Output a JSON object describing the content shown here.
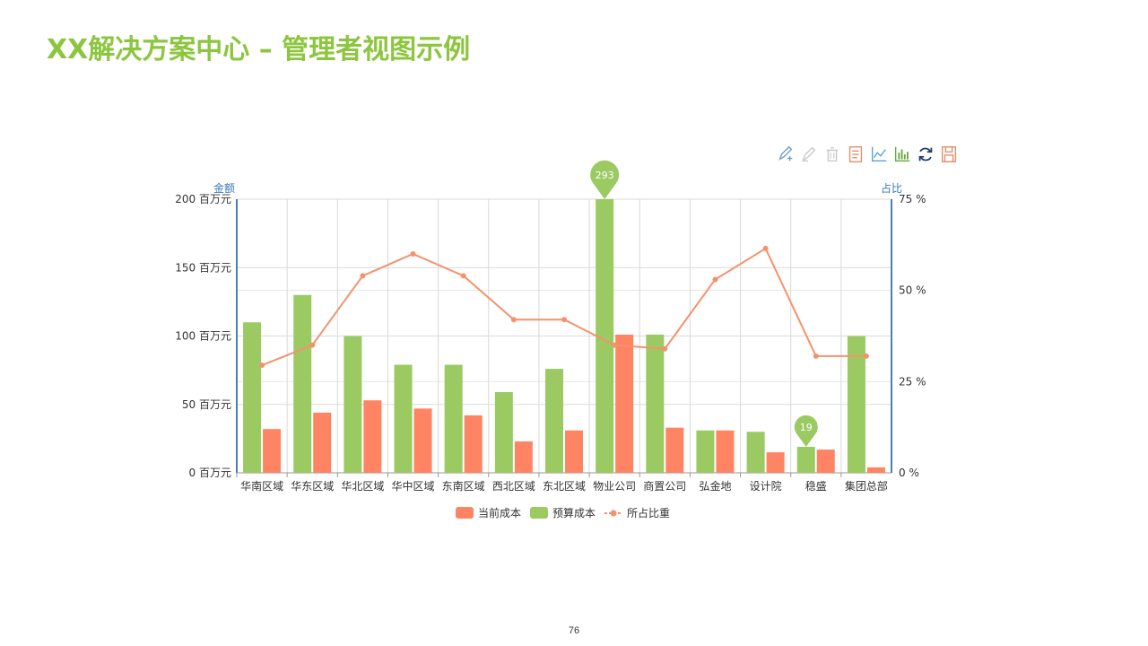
{
  "page": {
    "title": "XX解决方案中心 – 管理者视图示例",
    "page_number": "76"
  },
  "toolbox": [
    {
      "name": "mark-icon",
      "color": "#6d9ec9"
    },
    {
      "name": "mark-undo-icon",
      "color": "#c9c9c9"
    },
    {
      "name": "mark-clear-icon",
      "color": "#c9c9c9"
    },
    {
      "name": "data-view-icon",
      "color": "#e2906a"
    },
    {
      "name": "line-chart-icon",
      "color": "#5aa0d8"
    },
    {
      "name": "bar-chart-icon",
      "color": "#6aa639"
    },
    {
      "name": "refresh-icon",
      "color": "#233e6b"
    },
    {
      "name": "save-image-icon",
      "color": "#e2906a"
    }
  ],
  "chart_data": {
    "type": "bar",
    "categories": [
      "华南区域",
      "华东区域",
      "华北区域",
      "华中区域",
      "东南区域",
      "西北区域",
      "东北区域",
      "物业公司",
      "商置公司",
      "弘金地",
      "设计院",
      "稳盛",
      "集团总部"
    ],
    "series": [
      {
        "name": "当前成本",
        "type": "bar",
        "color": "#ff8463",
        "axis": "left",
        "values": [
          32,
          44,
          53,
          47,
          42,
          23,
          31,
          101,
          33,
          31,
          15,
          17,
          4
        ]
      },
      {
        "name": "预算成本",
        "type": "bar",
        "color": "#9bca63",
        "axis": "left",
        "values": [
          110,
          130,
          100,
          79,
          79,
          59,
          76,
          293,
          101,
          31,
          30,
          19,
          100
        ]
      },
      {
        "name": "所占比重",
        "type": "line",
        "color": "#f4926e",
        "axis": "right",
        "values": [
          29.5,
          35,
          54,
          60,
          54,
          42,
          42,
          35,
          34,
          53,
          61.5,
          32,
          32
        ]
      }
    ],
    "fixes_note": "",
    "left_axis": {
      "label": "金额",
      "range": [
        0,
        200
      ],
      "ticks": [
        "0 百万元",
        "50 百万元",
        "100 百万元",
        "150 百万元",
        "200 百万元"
      ],
      "tick_values": [
        0,
        50,
        100,
        150,
        200
      ]
    },
    "right_axis": {
      "label": "占比",
      "range": [
        0,
        75
      ],
      "ticks": [
        "0 %",
        "25 %",
        "50 %",
        "75 %"
      ],
      "tick_values": [
        0,
        25,
        50,
        75
      ]
    },
    "mark_points": [
      {
        "series": "预算成本",
        "category": "物业公司",
        "label": "293",
        "type": "max"
      },
      {
        "series": "预算成本",
        "category": "稳盛",
        "label": "19",
        "type": "min"
      }
    ],
    "legend_placement": "bottom",
    "grid": true,
    "axis_color": "#4a7fb5"
  }
}
